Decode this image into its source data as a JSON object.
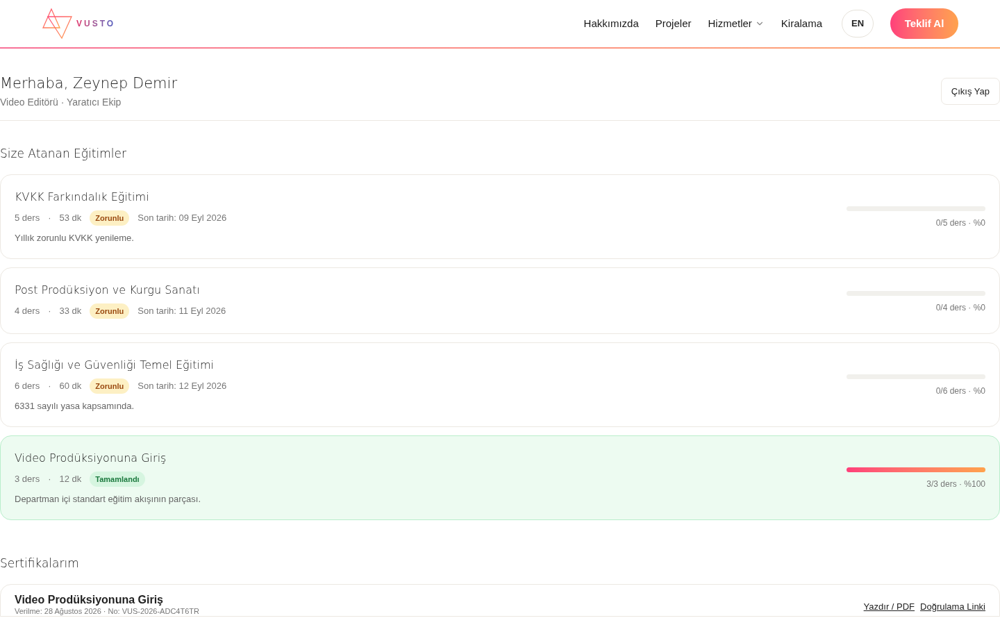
{
  "header": {
    "logo": "VUSTO",
    "nav": [
      {
        "label": "Hakkımızda",
        "dropdown": false
      },
      {
        "label": "Projeler",
        "dropdown": false
      },
      {
        "label": "Hizmetler",
        "dropdown": true
      },
      {
        "label": "Kiralama",
        "dropdown": false
      }
    ],
    "language": "EN",
    "cta": "Teklif Al"
  },
  "profile": {
    "greeting": "Merhaba, Zeynep Demir",
    "role": "Video Editörü · Yaratıcı Ekip",
    "logout": "Çıkış Yap"
  },
  "trainings_title": "Size Atanan Eğitimler",
  "trainings": [
    {
      "title": "KVKK Farkındalık Eğitimi",
      "lessons": "5 ders",
      "separator": "·",
      "duration": "53 dk",
      "status": {
        "kind": "required",
        "label": "Zorunlu"
      },
      "due": "Son tarih: 09 Eyl 2026",
      "description": "Yıllık zorunlu KVKK yenileme.",
      "level": 0,
      "progress": "0/5 ders · %0"
    },
    {
      "title": "Post Prodüksiyon ve Kurgu Sanatı",
      "lessons": "4 ders",
      "separator": "·",
      "duration": "33 dk",
      "status": {
        "kind": "required",
        "label": "Zorunlu"
      },
      "due": "Son tarih: 11 Eyl 2026",
      "level": 0,
      "progress": "0/4 ders · %0"
    },
    {
      "title": "İş Sağlığı ve Güvenliği Temel Eğitimi",
      "lessons": "6 ders",
      "separator": "·",
      "duration": "60 dk",
      "status": {
        "kind": "required",
        "label": "Zorunlu"
      },
      "due": "Son tarih: 12 Eyl 2026",
      "description": "6331 sayılı yasa kapsamında.",
      "level": 0,
      "progress": "0/6 ders · %0"
    },
    {
      "title": "Video Prodüksiyonuna Giriş",
      "lessons": "3 ders",
      "separator": "·",
      "duration": "12 dk",
      "status": {
        "kind": "completed",
        "label": "Tamamlandı"
      },
      "description": "Departman içi standart eğitim akışının parçası.",
      "level": 1,
      "progress": "3/3 ders · %100"
    }
  ],
  "certificates_title": "Sertifikalarım",
  "certificates": [
    {
      "title": "Video Prodüksiyonuna Giriş",
      "meta": "Verilme: 28 Ağustos 2026 · No: VUS-2026-ADC4T6TR",
      "links": [
        "Yazdır / PDF",
        "Doğrulama Linki"
      ]
    }
  ]
}
